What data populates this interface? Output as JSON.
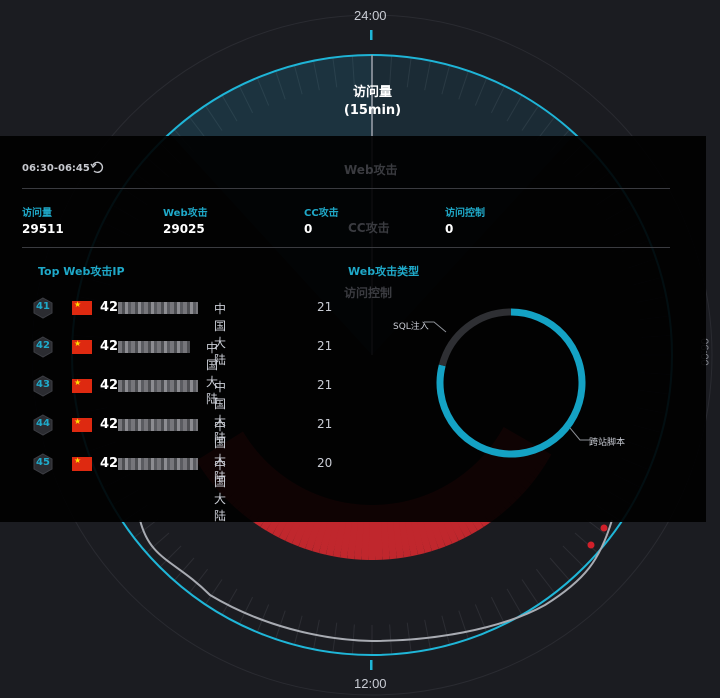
{
  "clock": {
    "top_label": "24:00",
    "bottom_label": "12:00",
    "right_label": "06:00"
  },
  "center": {
    "title": "访问量",
    "subtitle": "(15min)"
  },
  "panel": {
    "time_range": "06:30-06:45",
    "reset_icon": "undo-icon",
    "metrics": [
      {
        "label": "访问量",
        "value": "29511"
      },
      {
        "label": "Web攻击",
        "value": "29025"
      },
      {
        "label": "CC攻击",
        "value": "0"
      },
      {
        "label": "访问控制",
        "value": "0"
      }
    ],
    "ghost_labels": [
      "Web攻击",
      "CC攻击",
      "访问控制"
    ],
    "top_ip": {
      "title": "Top Web攻击IP",
      "rows": [
        {
          "rank": "41",
          "ip_prefix": "42",
          "region": "中国大陆",
          "count": "21"
        },
        {
          "rank": "42",
          "ip_prefix": "42",
          "region": "中国大陆",
          "count": "21"
        },
        {
          "rank": "43",
          "ip_prefix": "42",
          "region": "中国大陆",
          "count": "21"
        },
        {
          "rank": "44",
          "ip_prefix": "42",
          "region": "中国大陆",
          "count": "21"
        },
        {
          "rank": "45",
          "ip_prefix": "42",
          "region": "中国大陆",
          "count": "20"
        }
      ]
    },
    "attack_types": {
      "title": "Web攻击类型",
      "slices": [
        {
          "name": "跨站脚本",
          "share": 0.79,
          "color": "#14a2c4"
        },
        {
          "name": "SQL注入",
          "share": 0.21,
          "color": "#2e2f33"
        }
      ]
    }
  },
  "colors": {
    "accent": "#1fa9c9",
    "attack": "#c0272d",
    "ring": "#1fb6d8"
  }
}
